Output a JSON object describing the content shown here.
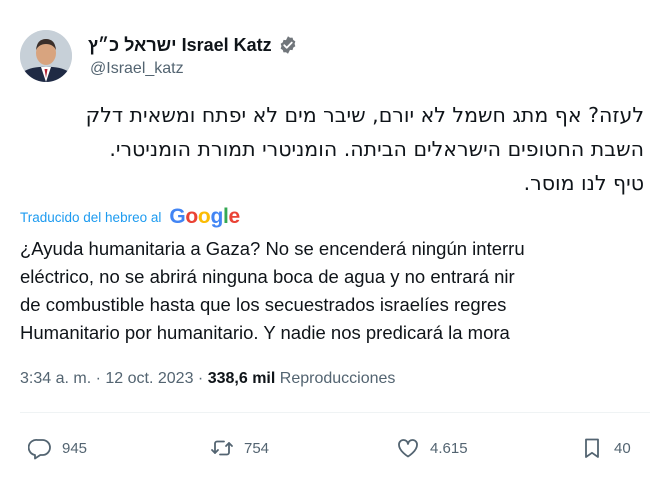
{
  "author": {
    "display_name": "ישראל כ״ץ Israel Katz",
    "handle": "@Israel_katz",
    "verified": true,
    "verified_color": "#1d9bf0"
  },
  "tweet": {
    "original_lines": [
      "לעזה? אף מתג חשמל לא יורם, שיבר מים לא יפתח ומשאית דלק",
      "השבת החטופים הישראלים הביתה. הומניטרי תמורת הומניטרי.",
      "טיף לנו מוסר."
    ],
    "translated_from": "Traducido del hebreo al",
    "translator_brand": "Google",
    "translation_lines": [
      "¿Ayuda humanitaria a Gaza? No se encenderá ningún interru",
      "eléctrico, no se abrirá ninguna boca de agua y no entrará nir",
      "de combustible hasta que los secuestrados israelíes regres",
      "Humanitario por humanitario. Y nadie nos predicará la mora"
    ],
    "time": "3:34 a. m.",
    "separator": "·",
    "date": "12 oct. 2023",
    "views_count": "338,6 mil",
    "views_label": "Reproducciones"
  },
  "actions": {
    "replies": "945",
    "retweets": "754",
    "likes": "4.615",
    "bookmarks": "40"
  },
  "colors": {
    "text": "#0f1419",
    "secondary": "#536471",
    "link": "#1d9bf0"
  }
}
